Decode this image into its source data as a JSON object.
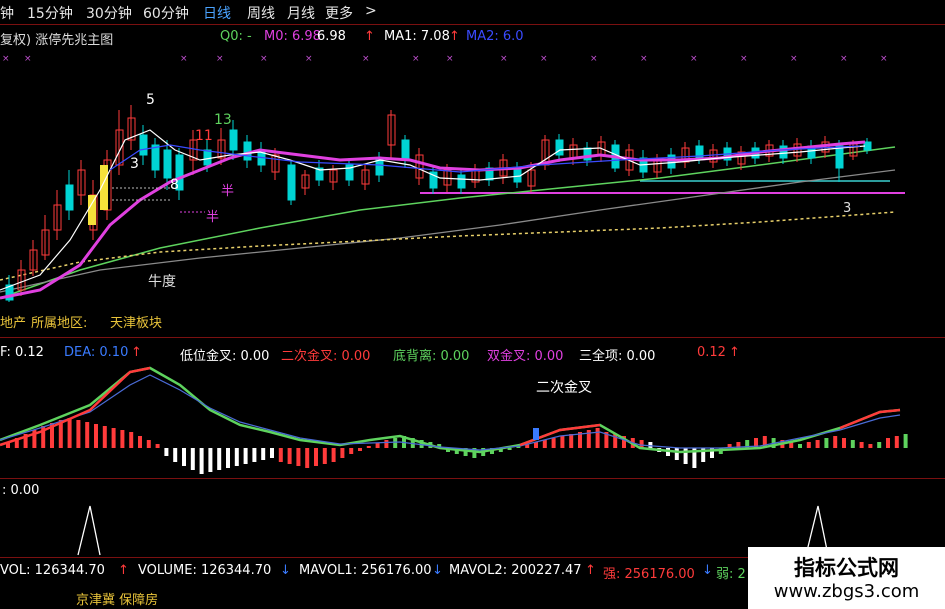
{
  "periods": {
    "items": [
      "钟",
      "15分钟",
      "30分钟",
      "60分钟",
      "日线",
      "周线",
      "月线",
      "更多",
      ">"
    ],
    "active": "日线"
  },
  "main_panel": {
    "title": "复权) 涨停先兆主图",
    "q0": "Q0: -",
    "m0": "M0: 6.98",
    "m0_val": "6.98",
    "ma1": "MA1: 7.08",
    "ma2": "MA2: 6.0",
    "annotations": {
      "peak": "5",
      "n3": "3",
      "n8": "8",
      "n11": "11",
      "n13": "13",
      "ban1": "半",
      "ban2": "半",
      "niudu": "牛度",
      "right3": "3"
    },
    "sector_prefix": "地产",
    "sector_label": "所属地区:",
    "sector_value": "天津板块"
  },
  "macd_panel": {
    "f": "F: 0.12",
    "dea": "DEA: 0.10",
    "dwjc": "低位金叉: 0.00",
    "ecjc": "二次金叉: 0.00",
    "dbl": "底背离: 0.00",
    "sjc": "双金叉: 0.00",
    "sqx": "三全项: 0.00",
    "last": "0.12",
    "annotation": "二次金叉"
  },
  "signal_panel": {
    "value": ": 0.00"
  },
  "volume_panel": {
    "vol": "VOL: 126344.70",
    "volume": "VOLUME: 126344.70",
    "mavol1": "MAVOL1: 256176.00",
    "mavol2": "MAVOL2: 200227.47",
    "qiang": "强: 256176.00",
    "ruo": "弱: 2"
  },
  "footer": {
    "tags": "京津冀 保障房"
  },
  "watermark": {
    "line1": "指标公式网",
    "line2": "www.zbgs3.com"
  },
  "colors": {
    "background": "#000000",
    "up": "#ff3b3b",
    "down": "#00d4d4",
    "ma_magenta": "#e040e0",
    "ma_white": "#ffffff",
    "ma_green": "#5ed35e",
    "ma_blue": "#3a4bff",
    "ma_yellow": "#e8d06a",
    "panel_border": "#7a1010",
    "active_period": "#4aa3ff"
  }
}
